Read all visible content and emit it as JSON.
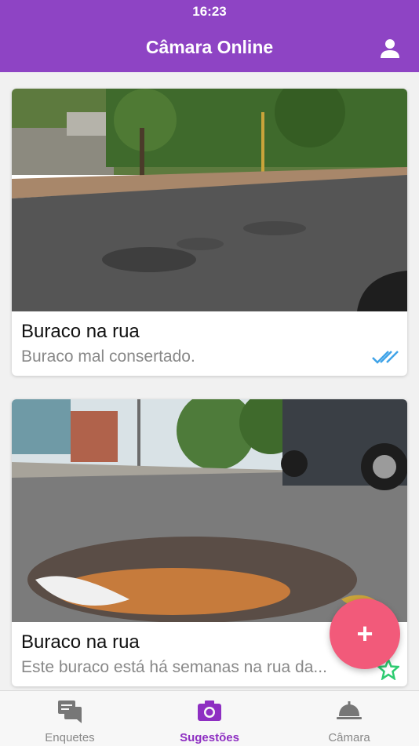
{
  "status_bar": {
    "time": "16:23"
  },
  "header": {
    "title": "Câmara Online",
    "profile_icon": "person-icon"
  },
  "suggestions": [
    {
      "title": "Buraco na rua",
      "description": "Buraco mal consertado.",
      "status_icon": "double-check-icon",
      "status_color": "#3fa3e8"
    },
    {
      "title": "Buraco na rua",
      "description": "Este buraco está há semanas na rua da...",
      "status_icon": "star-outline-icon",
      "status_color": "#2ecc71"
    }
  ],
  "fab": {
    "label": "+"
  },
  "tabs": [
    {
      "label": "Enquetes",
      "icon": "chat-icon",
      "active": false
    },
    {
      "label": "Sugestões",
      "icon": "camera-icon",
      "active": true
    },
    {
      "label": "Câmara",
      "icon": "dome-icon",
      "active": false
    }
  ],
  "colors": {
    "primary": "#8e44c4",
    "fab": "#f25a7a",
    "active_tab": "#8e2fc2"
  }
}
